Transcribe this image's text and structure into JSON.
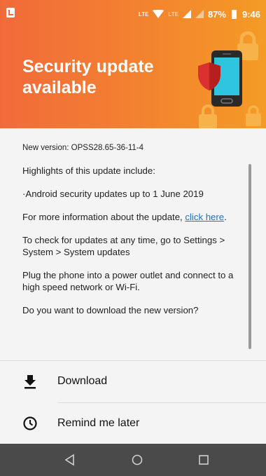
{
  "status_bar": {
    "network_label": "LTE",
    "network_label_2": "LTE",
    "battery": "87%",
    "time": "9:46"
  },
  "header": {
    "title": "Security update available"
  },
  "content": {
    "new_version": "New version: OPSS28.65-36-11-4",
    "highlights": "Highlights of this update include:",
    "bullet": "·Android security updates up to 1 June 2019",
    "more_info_prefix": "For more information about the update, ",
    "more_info_link": "click here",
    "more_info_suffix": ".",
    "check_updates": "To check for updates at any time, go to Settings > System > System updates",
    "plug_phone": "Plug the phone into a power outlet and connect to a high speed network or Wi-Fi.",
    "question": "Do you want to download the new version?"
  },
  "actions": {
    "download_label": "Download",
    "remind_label": "Remind me later"
  },
  "icons": {
    "download": "download-icon",
    "remind": "clock-icon",
    "back": "back-icon",
    "home": "home-icon",
    "recents": "recents-icon"
  },
  "colors": {
    "header_start": "#f26a3a",
    "header_end": "#f49b25",
    "link": "#1a73c8",
    "shield": "#d93030",
    "phone_screen": "#2fc4e0",
    "navbar": "#4a4a4a"
  }
}
